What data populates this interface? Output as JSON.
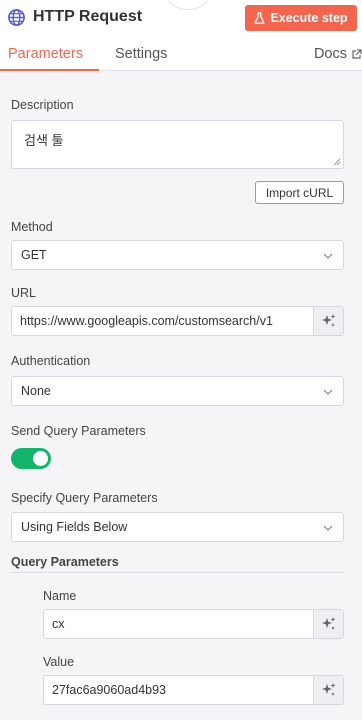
{
  "header": {
    "title": "HTTP Request",
    "execute_label": "Execute step"
  },
  "tabs": [
    {
      "label": "Parameters"
    },
    {
      "label": "Settings"
    }
  ],
  "docs_label": "Docs",
  "fields": {
    "description": {
      "label": "Description",
      "value": "검색 툴"
    },
    "import_label": "Import cURL",
    "method": {
      "label": "Method",
      "value": "GET"
    },
    "url": {
      "label": "URL",
      "value": "https://www.googleapis.com/customsearch/v1"
    },
    "authentication": {
      "label": "Authentication",
      "value": "None"
    },
    "send_query": {
      "label": "Send Query Parameters",
      "enabled": true
    },
    "specify_query": {
      "label": "Specify Query Parameters",
      "value": "Using Fields Below"
    },
    "query_section": "Query Parameters",
    "name": {
      "label": "Name",
      "value": "cx"
    },
    "param_value": {
      "label": "Value",
      "value": "27fac6a9060ad4b93"
    }
  },
  "colors": {
    "accent": "#f26650",
    "toggle_on": "#14b46a"
  },
  "icons": [
    "globe-icon",
    "flask-icon",
    "external-link-icon",
    "chevron-down-icon",
    "sparkle-icon"
  ]
}
